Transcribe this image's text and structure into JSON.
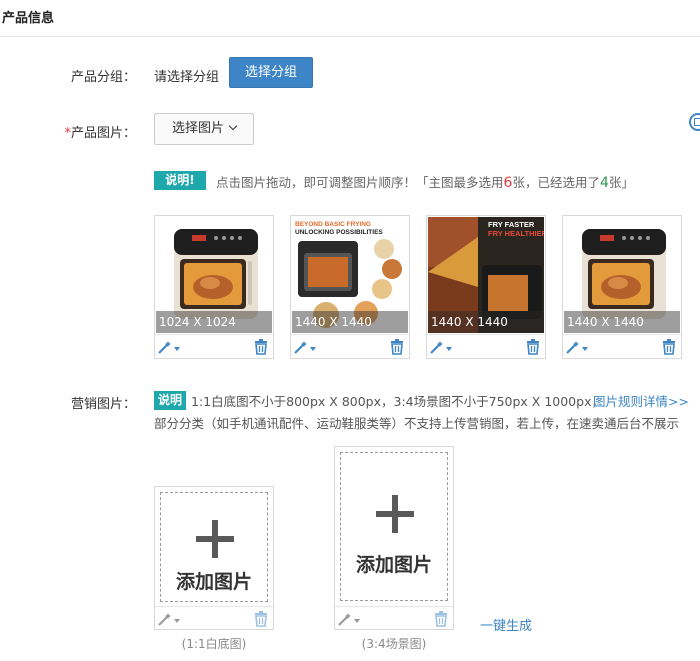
{
  "section": {
    "title": "产品信息"
  },
  "group": {
    "label": "产品分组：",
    "value": "请选择分组",
    "button": "选择分组"
  },
  "images": {
    "required_mark": "*",
    "label": "产品图片：",
    "select_button": "选择图片",
    "note_tag": "说明!",
    "note_text_a": "点击图片拖动，即可调整图片顺序！「主图最多选用",
    "max_count": "6",
    "note_text_b": "张，已经选用了",
    "used_count": "4",
    "note_text_c": "张」",
    "cards": [
      {
        "size": "1024 X 1024",
        "thumb": "air-fryer-oven-roast-chicken"
      },
      {
        "size": "1440 X 1440",
        "thumb": "air-fryer-beyond-basic-frying",
        "overlay_line1": "BEYOND BASIC FRYING",
        "overlay_line2": "UNLOCKING POSSIBILITIES"
      },
      {
        "size": "1440 X 1440",
        "thumb": "air-fryer-fry-faster",
        "overlay_line1": "FRY FASTER",
        "overlay_line2": "FRY HEALTHIER"
      },
      {
        "size": "1440 X 1440",
        "thumb": "air-fryer-oven-roast-chicken"
      }
    ]
  },
  "marketing": {
    "label": "营销图片：",
    "tag": "说明",
    "text1": "1:1白底图不小于800px X 800px，3:4场景图不小于750px X 1000px，",
    "link": "图片规则详情>>",
    "text2": "部分分类（如手机通讯配件、运动鞋服类等）不支持上传营销图，若上传，在速卖通后台不展示",
    "add_label": "添加图片",
    "caption_square": "(1:1白底图)",
    "caption_scene": "(3:4场景图)",
    "generate_link": "一键生成"
  },
  "colors": {
    "primary": "#3d85c6",
    "teal": "#1fa8ab",
    "red": "#e4393c",
    "green": "#2b9a4a"
  }
}
